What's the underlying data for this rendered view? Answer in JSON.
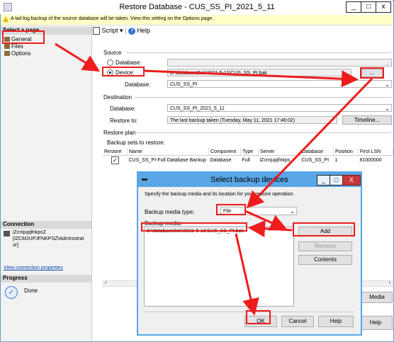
{
  "window": {
    "title": "Restore Database - CUS_SS_PI_2021_5_11",
    "minimize": "_",
    "restore": "□",
    "close": "x"
  },
  "warning": "A tail-log backup of the source database will be taken. View this setting on the Options page.",
  "left": {
    "select_page": "Select a page",
    "pages": [
      "General",
      "Files",
      "Options"
    ],
    "connection_header": "Connection",
    "connection_text_1": "iZcmjupjfnkpsZ",
    "connection_text_2": "[IZCMJUPJFNKPSZ\\Administrat",
    "connection_text_3": "or]",
    "view_connection": "View connection properties",
    "progress_header": "Progress",
    "progress_status": "Done"
  },
  "toolbar": {
    "script": "Script",
    "help": "Help"
  },
  "source": {
    "label": "Source",
    "database_radio": "Database:",
    "device_radio": "Device:",
    "device_value": "D:\\databaseBak\\2021-5-11\\CUS_SS_PI.bak",
    "browse": "...",
    "database_label": "Database:",
    "database_value": "CUS_SS_PI"
  },
  "destination": {
    "label": "Destination",
    "database_label": "Database:",
    "database_value": "CUS_SS_PI_2021_5_11",
    "restore_to_label": "Restore to:",
    "restore_to_value": "The last backup taken (Tuesday, May 11, 2021 17:46:02)",
    "timeline": "Timeline..."
  },
  "restore_plan": {
    "label": "Restore plan",
    "sets_label": "Backup sets to restore:",
    "columns": [
      "Restore",
      "Name",
      "Component",
      "Type",
      "Server",
      "Database",
      "Position",
      "First LSN"
    ],
    "row": [
      "",
      "CUS_SS_PI-Full Database Backup",
      "Database",
      "Full",
      "iZcmjupjfnkps",
      "CUS_SS_PI",
      "1",
      "81000000"
    ]
  },
  "main_buttons": {
    "media": "Media",
    "help": "Help"
  },
  "dialog": {
    "title": "Select backup devices",
    "instructions": "Specify the backup media and its location for your restore operation.",
    "media_type_label": "Backup media type:",
    "media_type_value": "File",
    "media_label": "Backup media:",
    "media_item": "D:\\databaseBak\\2021-5-11\\CUS_SS_PI.bak",
    "add": "Add",
    "remove": "Remove",
    "contents": "Contents",
    "ok": "OK",
    "cancel": "Cancel",
    "help": "Help",
    "min": "_",
    "max": "□",
    "close": "X"
  },
  "colors": {
    "accent": "#5aa6e6",
    "annotation": "#ee1c1c",
    "warning_bg": "#ffffc6"
  }
}
